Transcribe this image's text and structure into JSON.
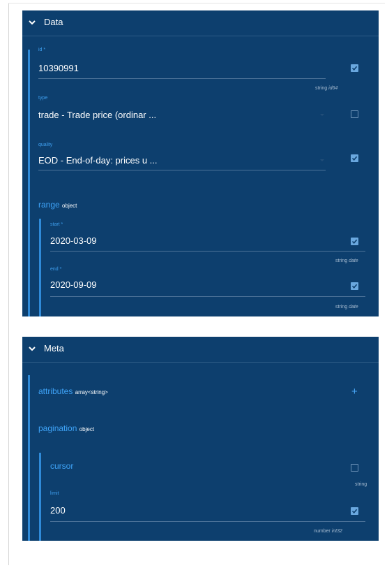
{
  "colors": {
    "panel_bg": "#0d3f6e",
    "accent": "#3ea3f7",
    "checkbox_checked": "#6aa8df",
    "hint_text": "#a8bdd2"
  },
  "data_panel": {
    "title": "Data",
    "id": {
      "label": "id *",
      "value": "10390991",
      "checked": true,
      "type": "string",
      "format": "id64"
    },
    "type": {
      "label": "type",
      "value": "trade - Trade price (ordinar ...",
      "checked": false
    },
    "quality": {
      "label": "quality",
      "value": "EOD - End-of-day: prices u ...",
      "checked": true
    },
    "range": {
      "title": "range",
      "kind": "object",
      "start": {
        "label": "start *",
        "value": "2020-03-09",
        "checked": true,
        "type": "string",
        "format": "date"
      },
      "end": {
        "label": "end *",
        "value": "2020-09-09",
        "checked": true,
        "type": "string",
        "format": "date"
      }
    }
  },
  "meta_panel": {
    "title": "Meta",
    "attributes": {
      "title": "attributes",
      "kind": "array<string>"
    },
    "pagination": {
      "title": "pagination",
      "kind": "object",
      "cursor": {
        "label": "cursor",
        "checked": false,
        "type": "string"
      },
      "limit": {
        "label": "limit",
        "value": "200",
        "checked": true,
        "type": "number",
        "format": "int32"
      }
    }
  },
  "icons": {
    "collapse": "chevron-down-icon",
    "add": "plus-icon",
    "dropdown": "caret-down-icon",
    "check": "checkmark-icon"
  }
}
